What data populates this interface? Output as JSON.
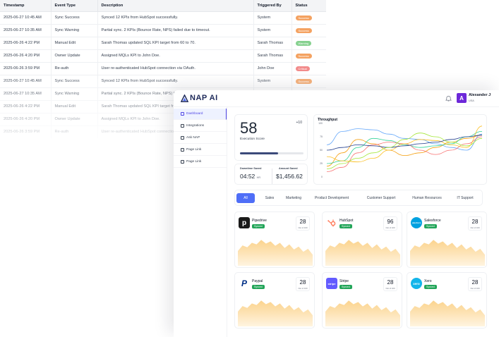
{
  "event_table": {
    "columns": [
      "Timestamp",
      "Event Type",
      "Description",
      "Triggered By",
      "Status"
    ],
    "rows": [
      {
        "timestamp": "2025-06-27 10:45 AM",
        "event": "Sync Success",
        "description": "Synced 12 KPIs from HubSpot successfully.",
        "by": "System",
        "status": "Success",
        "status_color": "#f4a261"
      },
      {
        "timestamp": "2025-06-27 10:35 AM",
        "event": "Sync Warning",
        "description": "Partial sync. 2 KPIs (Bounce Rate, NPS) failed due to timeout.",
        "by": "System",
        "status": "Success",
        "status_color": "#f4a261"
      },
      {
        "timestamp": "2025-06-26 4:22 PM",
        "event": "Manual Edit",
        "description": "Sarah Thomas updated SQL KPI target from 60 to 70.",
        "by": "Sarah Thomas",
        "status": "Warning",
        "status_color": "#86d18f"
      },
      {
        "timestamp": "2025-06-26 4:20 PM",
        "event": "Owner Update",
        "description": "Assigned MQLs KPI to John Doe.",
        "by": "Sarah Thomas",
        "status": "Success",
        "status_color": "#f4a261"
      },
      {
        "timestamp": "2025-06-26 3:59 PM",
        "event": "Re-auth",
        "description": "User re-authenticated HubSpot connection via OAuth.",
        "by": "John Doe",
        "status": "Critical",
        "status_color": "#f28b8b"
      },
      {
        "timestamp": "2025-06-27 10:45 AM",
        "event": "Sync Success",
        "description": "Synced 12 KPIs from HubSpot successfully.",
        "by": "System",
        "status": "Success",
        "status_color": "#f4a261"
      },
      {
        "timestamp": "2025-06-27 10:35 AM",
        "event": "Sync Warning",
        "description": "Partial sync. 2 KPIs (Bounce Rate, NPS) failed due to timeout.",
        "by": "System",
        "status": "Success",
        "status_color": "#f4a261"
      },
      {
        "timestamp": "2025-06-26 4:22 PM",
        "event": "Manual Edit",
        "description": "Sarah Thomas updated SQL KPI target from 60 to 70.",
        "by": "Sarah Thomas",
        "status": "Warning",
        "status_color": "#86d18f"
      },
      {
        "timestamp": "2025-06-26 4:20 PM",
        "event": "Owner Update",
        "description": "Assigned MQLs KPI to John Doe.",
        "by": "Sarah Thomas",
        "status": "Success",
        "status_color": "#f4a261"
      },
      {
        "timestamp": "2025-06-26 3:59 PM",
        "event": "Re-auth",
        "description": "User re-authenticated HubSpot connection via OAuth.",
        "by": "John Doe",
        "status": "Critical",
        "status_color": "#f28b8b"
      }
    ]
  },
  "app": {
    "logo_text": "NAP AI",
    "user": {
      "initial": "A",
      "name": "Alexander J",
      "subtitle": "USA"
    },
    "sidebar": [
      {
        "label": "Dashboard",
        "active": true
      },
      {
        "label": "Integrations",
        "active": false
      },
      {
        "label": "Ask NAP",
        "active": false
      },
      {
        "label": "Page Link",
        "active": false
      },
      {
        "label": "Page Link",
        "active": false
      }
    ],
    "collapse_glyph": "«",
    "execution": {
      "score": "58",
      "delta": "+10",
      "label": "Execution Score",
      "progress": 0.6
    },
    "downtime": {
      "label": "Downtime Saved",
      "value": "04:52",
      "unit": "HR"
    },
    "amount": {
      "label": "Amount Saved",
      "value": "$1,456.62"
    },
    "throughput": {
      "title": "Throughput"
    },
    "tabs": [
      "All",
      "Sales",
      "Marketing",
      "Product Development",
      "Customer Support",
      "Human Resources",
      "IT Support"
    ],
    "active_tab": 0,
    "integrations": [
      {
        "name": "Pipedrive",
        "badge": "Synced",
        "score": "28",
        "score_sub": "Out of 100",
        "logo": "p",
        "logo_color": "#1a1a1a"
      },
      {
        "name": "HubSpot",
        "badge": "Synced",
        "score": "96",
        "score_sub": "Out of 100",
        "logo": "hubspot",
        "logo_color": "#ff7a59"
      },
      {
        "name": "Salesforce",
        "badge": "Synced",
        "score": "28",
        "score_sub": "Out of 100",
        "logo": "salesforce",
        "logo_color": "#00a1e0"
      },
      {
        "name": "Paypal",
        "badge": "Synced",
        "score": "28",
        "score_sub": "Out of 100",
        "logo": "P",
        "logo_color": "#003087"
      },
      {
        "name": "Stripe",
        "badge": "Synced",
        "score": "28",
        "score_sub": "Out of 100",
        "logo": "stripe",
        "logo_color": "#635bff"
      },
      {
        "name": "Xero",
        "badge": "Synced",
        "score": "28",
        "score_sub": "Out of 100",
        "logo": "xero",
        "logo_color": "#13b5ea"
      }
    ]
  },
  "chart_data": {
    "type": "line",
    "title": "Throughput",
    "y_ticks": [
      "100",
      "75",
      "50",
      "25",
      "0"
    ],
    "ylim": [
      0,
      100
    ],
    "x": [
      0,
      1,
      2,
      3,
      4,
      5,
      6,
      7,
      8,
      9,
      10
    ],
    "series": [
      {
        "color": "#60a5fa",
        "values": [
          60,
          85,
          90,
          88,
          80,
          72,
          70,
          62,
          55,
          50,
          80
        ]
      },
      {
        "color": "#f59e0b",
        "values": [
          20,
          45,
          70,
          62,
          50,
          40,
          45,
          55,
          65,
          72,
          78
        ]
      },
      {
        "color": "#34d399",
        "values": [
          25,
          30,
          55,
          72,
          68,
          60,
          55,
          58,
          62,
          75,
          85
        ]
      },
      {
        "color": "#f87171",
        "values": [
          10,
          18,
          45,
          60,
          65,
          62,
          50,
          42,
          50,
          62,
          75
        ]
      },
      {
        "color": "#fbbf24",
        "values": [
          38,
          30,
          28,
          35,
          50,
          62,
          70,
          68,
          60,
          55,
          95
        ]
      },
      {
        "color": "#1e3a8a",
        "values": [
          50,
          55,
          60,
          58,
          55,
          58,
          62,
          65,
          70,
          75,
          78
        ]
      },
      {
        "color": "#a3e635",
        "values": [
          15,
          25,
          35,
          45,
          55,
          70,
          82,
          75,
          65,
          58,
          72
        ]
      }
    ],
    "sparkline": [
      40,
      55,
      50,
      62,
      58,
      70,
      60,
      66,
      54,
      62,
      48,
      58,
      44,
      52,
      38,
      46,
      30
    ]
  }
}
